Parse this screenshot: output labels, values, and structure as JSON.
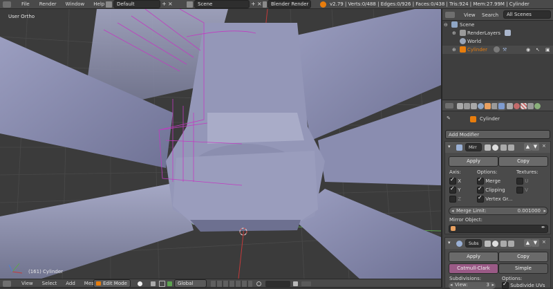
{
  "topbar": {
    "menus": [
      "File",
      "Render",
      "Window",
      "Help"
    ],
    "screen_layout": "Default",
    "scene": "Scene",
    "render_engine": "Blender Render",
    "stats": "v2.79 | Verts:0/488 | Edges:0/926 | Faces:0/438 | Tris:924 | Mem:27.99M | Cylinder"
  },
  "viewport": {
    "view_label": "User Ortho",
    "object_label": "(161) Cylinder"
  },
  "bottombar": {
    "menus": [
      "View",
      "Select",
      "Add",
      "Mesh"
    ],
    "mode": "Edit Mode",
    "orientation": "Global"
  },
  "outliner": {
    "header": {
      "view": "View",
      "search": "Search",
      "filter": "All Scenes"
    },
    "items": [
      {
        "label": "Scene"
      },
      {
        "label": "RenderLayers"
      },
      {
        "label": "World"
      },
      {
        "label": "Cylinder"
      }
    ]
  },
  "properties": {
    "object_name": "Cylinder",
    "add_modifier": "Add Modifier",
    "mirror": {
      "name": "Mirr",
      "apply": "Apply",
      "copy": "Copy",
      "axis_title": "Axis:",
      "options_title": "Options:",
      "textures_title": "Textures:",
      "axes": [
        {
          "label": "X",
          "on": true
        },
        {
          "label": "Y",
          "on": true
        },
        {
          "label": "Z",
          "on": false
        }
      ],
      "options": [
        {
          "label": "Merge",
          "on": true
        },
        {
          "label": "Clipping",
          "on": true
        },
        {
          "label": "Vertex Gr...",
          "on": true
        }
      ],
      "textures": [
        {
          "label": "U",
          "on": false
        },
        {
          "label": "V",
          "on": false
        }
      ],
      "merge_limit_label": "Merge Limit:",
      "merge_limit_value": "0.001000",
      "mirror_object_label": "Mirror Object:"
    },
    "subsurf": {
      "name": "Subs",
      "apply": "Apply",
      "copy": "Copy",
      "tab_catmull": "Catmull-Clark",
      "tab_simple": "Simple",
      "subdivisions_title": "Subdivisions:",
      "options_title": "Options:",
      "view_label": "View:",
      "view_value": "3",
      "subdivide_uvs": "Subdivide UVs"
    }
  },
  "colors": {
    "accent": "#e87d0d",
    "selected_tab": "#9a5a86",
    "viewport_bg": "#393939",
    "mesh": "#8f92b2",
    "wire": "#c13bc1"
  }
}
